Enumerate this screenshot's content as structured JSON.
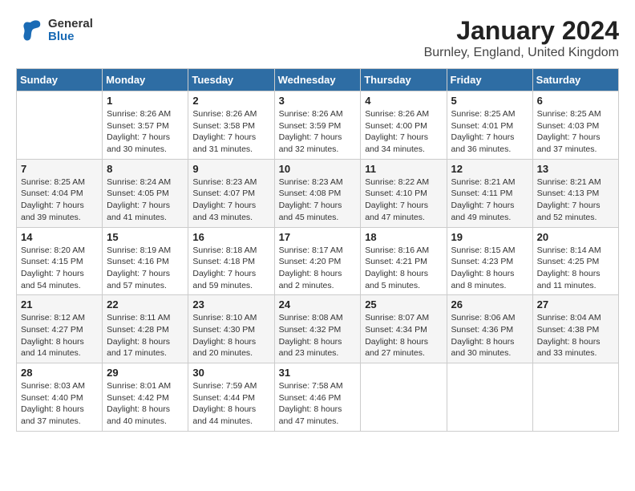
{
  "header": {
    "logo_general": "General",
    "logo_blue": "Blue",
    "month_title": "January 2024",
    "location": "Burnley, England, United Kingdom"
  },
  "days_of_week": [
    "Sunday",
    "Monday",
    "Tuesday",
    "Wednesday",
    "Thursday",
    "Friday",
    "Saturday"
  ],
  "weeks": [
    [
      {
        "day": "",
        "sunrise": "",
        "sunset": "",
        "daylight": ""
      },
      {
        "day": "1",
        "sunrise": "Sunrise: 8:26 AM",
        "sunset": "Sunset: 3:57 PM",
        "daylight": "Daylight: 7 hours and 30 minutes."
      },
      {
        "day": "2",
        "sunrise": "Sunrise: 8:26 AM",
        "sunset": "Sunset: 3:58 PM",
        "daylight": "Daylight: 7 hours and 31 minutes."
      },
      {
        "day": "3",
        "sunrise": "Sunrise: 8:26 AM",
        "sunset": "Sunset: 3:59 PM",
        "daylight": "Daylight: 7 hours and 32 minutes."
      },
      {
        "day": "4",
        "sunrise": "Sunrise: 8:26 AM",
        "sunset": "Sunset: 4:00 PM",
        "daylight": "Daylight: 7 hours and 34 minutes."
      },
      {
        "day": "5",
        "sunrise": "Sunrise: 8:25 AM",
        "sunset": "Sunset: 4:01 PM",
        "daylight": "Daylight: 7 hours and 36 minutes."
      },
      {
        "day": "6",
        "sunrise": "Sunrise: 8:25 AM",
        "sunset": "Sunset: 4:03 PM",
        "daylight": "Daylight: 7 hours and 37 minutes."
      }
    ],
    [
      {
        "day": "7",
        "sunrise": "Sunrise: 8:25 AM",
        "sunset": "Sunset: 4:04 PM",
        "daylight": "Daylight: 7 hours and 39 minutes."
      },
      {
        "day": "8",
        "sunrise": "Sunrise: 8:24 AM",
        "sunset": "Sunset: 4:05 PM",
        "daylight": "Daylight: 7 hours and 41 minutes."
      },
      {
        "day": "9",
        "sunrise": "Sunrise: 8:23 AM",
        "sunset": "Sunset: 4:07 PM",
        "daylight": "Daylight: 7 hours and 43 minutes."
      },
      {
        "day": "10",
        "sunrise": "Sunrise: 8:23 AM",
        "sunset": "Sunset: 4:08 PM",
        "daylight": "Daylight: 7 hours and 45 minutes."
      },
      {
        "day": "11",
        "sunrise": "Sunrise: 8:22 AM",
        "sunset": "Sunset: 4:10 PM",
        "daylight": "Daylight: 7 hours and 47 minutes."
      },
      {
        "day": "12",
        "sunrise": "Sunrise: 8:21 AM",
        "sunset": "Sunset: 4:11 PM",
        "daylight": "Daylight: 7 hours and 49 minutes."
      },
      {
        "day": "13",
        "sunrise": "Sunrise: 8:21 AM",
        "sunset": "Sunset: 4:13 PM",
        "daylight": "Daylight: 7 hours and 52 minutes."
      }
    ],
    [
      {
        "day": "14",
        "sunrise": "Sunrise: 8:20 AM",
        "sunset": "Sunset: 4:15 PM",
        "daylight": "Daylight: 7 hours and 54 minutes."
      },
      {
        "day": "15",
        "sunrise": "Sunrise: 8:19 AM",
        "sunset": "Sunset: 4:16 PM",
        "daylight": "Daylight: 7 hours and 57 minutes."
      },
      {
        "day": "16",
        "sunrise": "Sunrise: 8:18 AM",
        "sunset": "Sunset: 4:18 PM",
        "daylight": "Daylight: 7 hours and 59 minutes."
      },
      {
        "day": "17",
        "sunrise": "Sunrise: 8:17 AM",
        "sunset": "Sunset: 4:20 PM",
        "daylight": "Daylight: 8 hours and 2 minutes."
      },
      {
        "day": "18",
        "sunrise": "Sunrise: 8:16 AM",
        "sunset": "Sunset: 4:21 PM",
        "daylight": "Daylight: 8 hours and 5 minutes."
      },
      {
        "day": "19",
        "sunrise": "Sunrise: 8:15 AM",
        "sunset": "Sunset: 4:23 PM",
        "daylight": "Daylight: 8 hours and 8 minutes."
      },
      {
        "day": "20",
        "sunrise": "Sunrise: 8:14 AM",
        "sunset": "Sunset: 4:25 PM",
        "daylight": "Daylight: 8 hours and 11 minutes."
      }
    ],
    [
      {
        "day": "21",
        "sunrise": "Sunrise: 8:12 AM",
        "sunset": "Sunset: 4:27 PM",
        "daylight": "Daylight: 8 hours and 14 minutes."
      },
      {
        "day": "22",
        "sunrise": "Sunrise: 8:11 AM",
        "sunset": "Sunset: 4:28 PM",
        "daylight": "Daylight: 8 hours and 17 minutes."
      },
      {
        "day": "23",
        "sunrise": "Sunrise: 8:10 AM",
        "sunset": "Sunset: 4:30 PM",
        "daylight": "Daylight: 8 hours and 20 minutes."
      },
      {
        "day": "24",
        "sunrise": "Sunrise: 8:08 AM",
        "sunset": "Sunset: 4:32 PM",
        "daylight": "Daylight: 8 hours and 23 minutes."
      },
      {
        "day": "25",
        "sunrise": "Sunrise: 8:07 AM",
        "sunset": "Sunset: 4:34 PM",
        "daylight": "Daylight: 8 hours and 27 minutes."
      },
      {
        "day": "26",
        "sunrise": "Sunrise: 8:06 AM",
        "sunset": "Sunset: 4:36 PM",
        "daylight": "Daylight: 8 hours and 30 minutes."
      },
      {
        "day": "27",
        "sunrise": "Sunrise: 8:04 AM",
        "sunset": "Sunset: 4:38 PM",
        "daylight": "Daylight: 8 hours and 33 minutes."
      }
    ],
    [
      {
        "day": "28",
        "sunrise": "Sunrise: 8:03 AM",
        "sunset": "Sunset: 4:40 PM",
        "daylight": "Daylight: 8 hours and 37 minutes."
      },
      {
        "day": "29",
        "sunrise": "Sunrise: 8:01 AM",
        "sunset": "Sunset: 4:42 PM",
        "daylight": "Daylight: 8 hours and 40 minutes."
      },
      {
        "day": "30",
        "sunrise": "Sunrise: 7:59 AM",
        "sunset": "Sunset: 4:44 PM",
        "daylight": "Daylight: 8 hours and 44 minutes."
      },
      {
        "day": "31",
        "sunrise": "Sunrise: 7:58 AM",
        "sunset": "Sunset: 4:46 PM",
        "daylight": "Daylight: 8 hours and 47 minutes."
      },
      {
        "day": "",
        "sunrise": "",
        "sunset": "",
        "daylight": ""
      },
      {
        "day": "",
        "sunrise": "",
        "sunset": "",
        "daylight": ""
      },
      {
        "day": "",
        "sunrise": "",
        "sunset": "",
        "daylight": ""
      }
    ]
  ]
}
